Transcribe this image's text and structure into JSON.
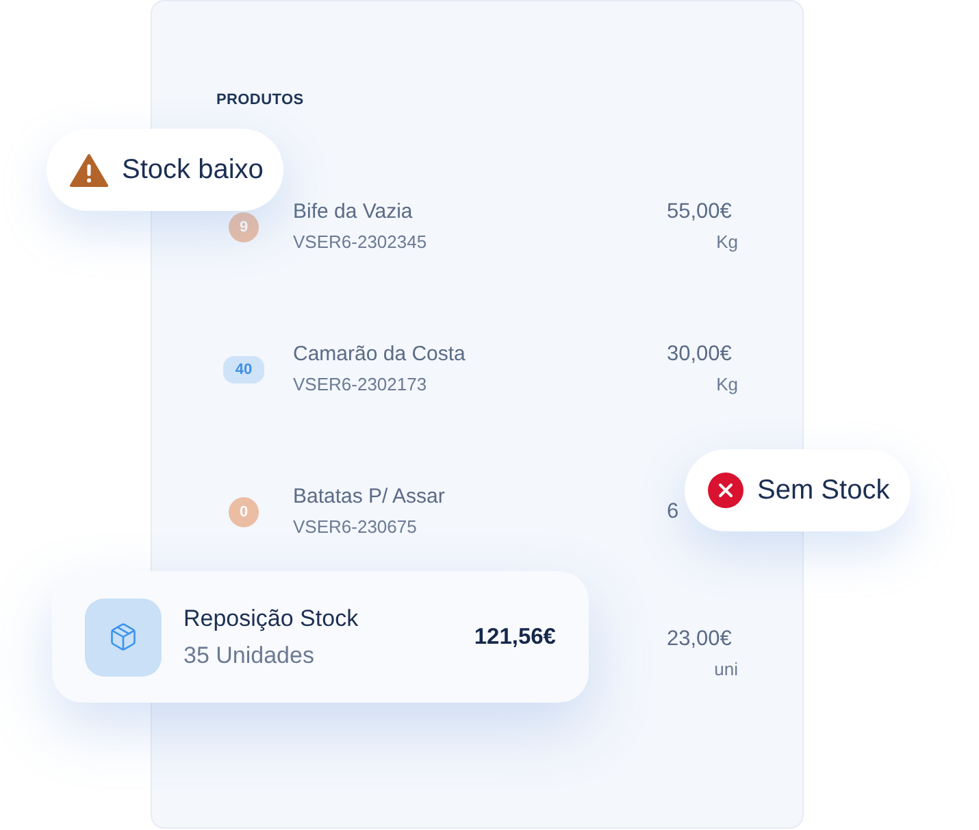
{
  "panel": {
    "heading": "PRODUTOS",
    "rows": [
      {
        "badge": {
          "label": "9",
          "kind": "warning"
        },
        "name": "Bife da Vazia",
        "code": "VSER6-2302345",
        "price": "55,00€",
        "unit": "Kg"
      },
      {
        "badge": {
          "label": "40",
          "kind": "normal"
        },
        "name": "Camarão da Costa",
        "code": "VSER6-2302173",
        "price": "30,00€",
        "unit": "Kg"
      },
      {
        "badge": {
          "label": "0",
          "kind": "warning"
        },
        "name": "Batatas P/ Assar",
        "code": "VSER6-230675",
        "price": "6"
      },
      {
        "price": "23,00€",
        "unit": "uni"
      }
    ]
  },
  "alerts": [
    {
      "kind": "warning",
      "label": "Stock baixo"
    },
    {
      "kind": "error",
      "label": "Sem Stock"
    }
  ],
  "restock_card": {
    "title": "Reposição Stock",
    "subtitle": "35 Unidades",
    "total": "121,56€"
  }
}
